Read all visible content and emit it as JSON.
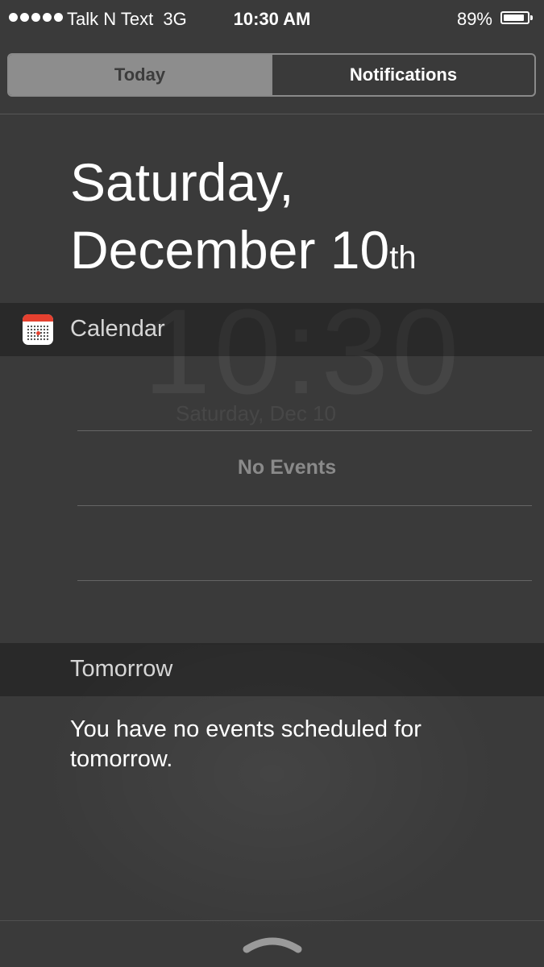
{
  "status_bar": {
    "carrier": "Talk N Text",
    "network": "3G",
    "time": "10:30 AM",
    "battery_percent": "89%",
    "battery_level": 0.89,
    "signal_bars": 5
  },
  "tabs": [
    {
      "label": "Today",
      "active": true
    },
    {
      "label": "Notifications",
      "active": false
    }
  ],
  "date_header": {
    "line1": "Saturday,",
    "line2": "December 10",
    "suffix": "th"
  },
  "calendar": {
    "title": "Calendar",
    "icon": "calendar-icon",
    "empty_text": "No Events"
  },
  "tomorrow": {
    "title": "Tomorrow",
    "message": "You have no events scheduled for tomorrow."
  },
  "background": {
    "clock": "10:30",
    "date": "Saturday, Dec 10"
  },
  "colors": {
    "background": "#3a3a3a",
    "active_tab": "#8d8d8d",
    "calendar_red": "#e5402f"
  }
}
